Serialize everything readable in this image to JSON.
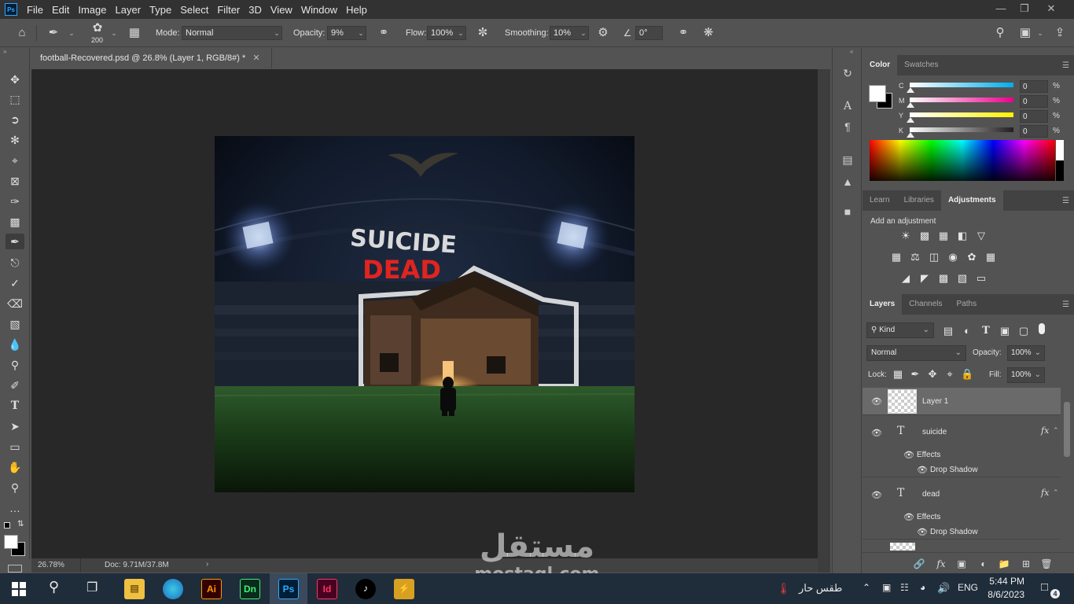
{
  "menubar": {
    "logo": "Ps",
    "items": [
      "File",
      "Edit",
      "Image",
      "Layer",
      "Type",
      "Select",
      "Filter",
      "3D",
      "View",
      "Window",
      "Help"
    ],
    "window_controls": [
      "minimize",
      "restore",
      "close"
    ]
  },
  "options": {
    "brush_size": "200",
    "mode_label": "Mode:",
    "mode_value": "Normal",
    "opacity_label": "Opacity:",
    "opacity_value": "9%",
    "flow_label": "Flow:",
    "flow_value": "100%",
    "smoothing_label": "Smoothing:",
    "smoothing_value": "10%",
    "angle_value": "0°"
  },
  "document": {
    "tab_title": "football-Recovered.psd @ 26.8% (Layer 1, RGB/8#) *",
    "zoom": "26.78%",
    "doc_size": "Doc: 9.71M/37.8M",
    "artwork": {
      "title_top": "SUICIDE",
      "title_bottom": "DEAD"
    }
  },
  "color_panel": {
    "tabs": [
      "Color",
      "Swatches"
    ],
    "active_tab": "Color",
    "channels": [
      {
        "label": "C",
        "value": "0",
        "unit": "%",
        "color": "#00aeef"
      },
      {
        "label": "M",
        "value": "0",
        "unit": "%",
        "color": "#ec008c"
      },
      {
        "label": "Y",
        "value": "0",
        "unit": "%",
        "color": "#fff200"
      },
      {
        "label": "K",
        "value": "0",
        "unit": "%",
        "color": "#231f20"
      }
    ],
    "foreground": "#ffffff",
    "background": "#000000"
  },
  "adjustments_panel": {
    "tabs": [
      "Learn",
      "Libraries",
      "Adjustments"
    ],
    "active_tab": "Adjustments",
    "heading": "Add an adjustment"
  },
  "layers_panel": {
    "tabs": [
      "Layers",
      "Channels",
      "Paths"
    ],
    "active_tab": "Layers",
    "filter_kind": "Kind",
    "blend_mode": "Normal",
    "opacity_label": "Opacity:",
    "opacity_value": "100%",
    "lock_label": "Lock:",
    "fill_label": "Fill:",
    "fill_value": "100%",
    "layers": [
      {
        "name": "Layer 1",
        "type": "pixel",
        "selected": true
      },
      {
        "name": "suicide",
        "type": "text",
        "fx": "fx",
        "effects_label": "Effects",
        "effect": "Drop Shadow"
      },
      {
        "name": "dead",
        "type": "text",
        "fx": "fx",
        "effects_label": "Effects",
        "effect": "Drop Shadow"
      }
    ]
  },
  "taskbar": {
    "apps": [
      "File Explorer",
      "Edge",
      "Ai",
      "Dn",
      "Ps",
      "Id",
      "TikTok",
      "Other"
    ],
    "weather": "طقس حار",
    "language": "ENG",
    "time": "5:44 PM",
    "date": "8/6/2023",
    "notifications": "4"
  },
  "watermark": {
    "arabic": "مستقل",
    "latin": "mostaql.com"
  }
}
